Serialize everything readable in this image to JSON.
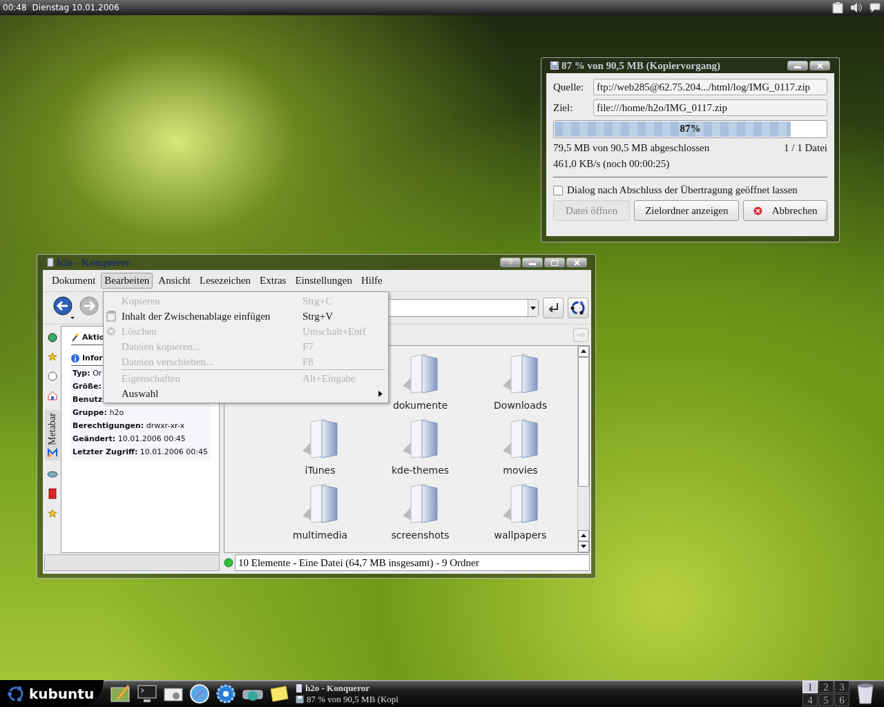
{
  "top_panel": {
    "clock": "00:48",
    "date": "Dienstag  10.01.2006"
  },
  "copy_dialog": {
    "title": "87 % von 90,5 MB  (Kopiervorgang)",
    "source_label": "Quelle:",
    "source": "ftp://web285@62.75.204.../html/log/IMG_0117.zip",
    "dest_label": "Ziel:",
    "dest": "file:///home/h2o/IMG_0117.zip",
    "progress": {
      "level": 0.87,
      "text": "87%"
    },
    "done": "79,5 MB von 90,5 MB abgeschlossen",
    "files": "1 / 1 Datei",
    "speed": "461,0 KB/s (noch 00:00:25)",
    "keep_open": {
      "label": "Dialog nach Abschluss der Übertragung geöffnet lassen",
      "checked": false
    },
    "buttons": [
      {
        "label": "Datei öffnen",
        "disabled": true,
        "kind": "plain"
      },
      {
        "label": "Zielordner anzeigen",
        "disabled": false,
        "kind": "plain"
      },
      {
        "label": "Abbrechen",
        "disabled": false,
        "kind": "cancel"
      }
    ]
  },
  "konqueror": {
    "title": "h2o - Konqueror",
    "menu": [
      {
        "label": "Dokument",
        "selected": false
      },
      {
        "label": "Bearbeiten",
        "selected": true
      },
      {
        "label": "Ansicht",
        "selected": false
      },
      {
        "label": "Lesezeichen",
        "selected": false
      },
      {
        "label": "Extras",
        "selected": false
      },
      {
        "label": "Einstellungen",
        "selected": false
      },
      {
        "label": "Hilfe",
        "selected": false
      }
    ],
    "edit_menu": [
      {
        "kind": "item",
        "label": "Kopieren",
        "shortcut": "Strg+C",
        "disabled": true
      },
      {
        "kind": "item",
        "label": "Inhalt der Zwischenablage einfügen",
        "shortcut": "Strg+V",
        "disabled": false
      },
      {
        "kind": "item",
        "label": "Löschen",
        "shortcut": "Umschalt+Entf",
        "disabled": true
      },
      {
        "kind": "item",
        "label": "Dateien kopieren...",
        "shortcut": "F7",
        "disabled": true
      },
      {
        "kind": "item",
        "label": "Dateien verschieben...",
        "shortcut": "F8",
        "disabled": true
      },
      {
        "kind": "separator"
      },
      {
        "kind": "item",
        "label": "Eigenschaften",
        "shortcut": "Alt+Eingabe",
        "disabled": true
      },
      {
        "kind": "submenu",
        "label": "Auswahl",
        "disabled": false
      }
    ],
    "metabar_tab": "Metabar",
    "sidebar": {
      "actions_heading": "Aktio",
      "info_heading": "Infor",
      "rows": [
        {
          "key": "Typ:",
          "value": "Or"
        },
        {
          "key": "Größe:"
        },
        {
          "key": "Benutz"
        },
        {
          "key": "Gruppe:",
          "value": "h2o"
        },
        {
          "key": "Berechtigungen:",
          "value": "drwxr-xr-x"
        },
        {
          "key": "Geändert:",
          "value": "10.01.2006 00:45"
        },
        {
          "key": "Letzter Zugriff:",
          "value": "10.01.2006 00:45"
        }
      ]
    },
    "files": [
      {
        "label": "dokumente"
      },
      {
        "label": "Downloads"
      },
      {
        "label": "iTunes"
      },
      {
        "label": "kde-themes"
      },
      {
        "label": "movies"
      },
      {
        "label": "multimedia"
      },
      {
        "label": "screenshots"
      },
      {
        "label": "wallpapers"
      }
    ],
    "status": "10 Elemente - Eine Datei (64,7 MB insgesamt) - 9 Ordner"
  },
  "taskbar": {
    "start": "kubuntu",
    "tasks": [
      {
        "label": "h2o - Konqueror"
      },
      {
        "label": "87 % von 90,5 MB  (Kopi"
      }
    ],
    "desktops": [
      {
        "label": "1",
        "selected": true
      },
      {
        "label": "2",
        "selected": false
      },
      {
        "label": "3",
        "selected": false
      },
      {
        "label": "4",
        "selected": false
      },
      {
        "label": "5",
        "selected": false
      },
      {
        "label": "6",
        "selected": false
      }
    ]
  }
}
